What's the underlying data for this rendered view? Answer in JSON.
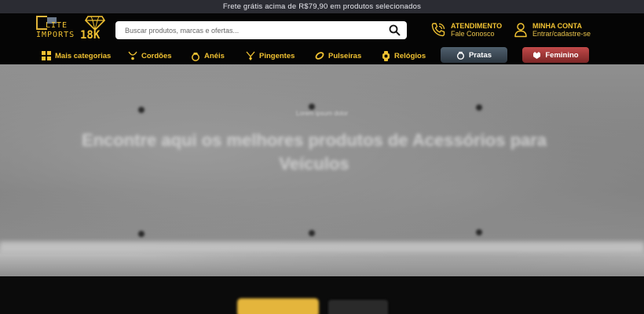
{
  "topbar": {
    "text": "Frete grátis acima de R$79,90 em produtos selecionados"
  },
  "brand": {
    "line1": "LITE",
    "line2": "IMPORTS",
    "badge": "18K"
  },
  "search": {
    "placeholder": "Buscar produtos, marcas e ofertas..."
  },
  "header_links": {
    "support": {
      "title": "ATENDIMENTO",
      "subtitle": "Fale Conosco",
      "icon": "phone-icon"
    },
    "account": {
      "title": "MINHA CONTA",
      "subtitle": "Entrar/cadastre-se",
      "icon": "user-icon"
    }
  },
  "nav": {
    "items": [
      {
        "label": "Mais categorias",
        "icon": "grid-icon"
      },
      {
        "label": "Cordões",
        "icon": "necklace-icon"
      },
      {
        "label": "Anéis",
        "icon": "ring-icon"
      },
      {
        "label": "Pingentes",
        "icon": "pendant-icon"
      },
      {
        "label": "Pulseiras",
        "icon": "bracelet-icon"
      },
      {
        "label": "Relógios",
        "icon": "watch-icon"
      }
    ],
    "pratas": {
      "label": "Pratas",
      "icon": "ring-icon"
    },
    "feminino": {
      "label": "Feminino",
      "icon": "female-icon"
    }
  },
  "hero": {
    "eyebrow": "Lorem ipsum dolor",
    "title": "Encontre aqui os melhores produtos de Acessórios para Veículos"
  },
  "colors": {
    "gold": "#f1c232",
    "pratas": "#3e4c58",
    "feminino": "#a33838",
    "topbar": "#2b2c33"
  }
}
